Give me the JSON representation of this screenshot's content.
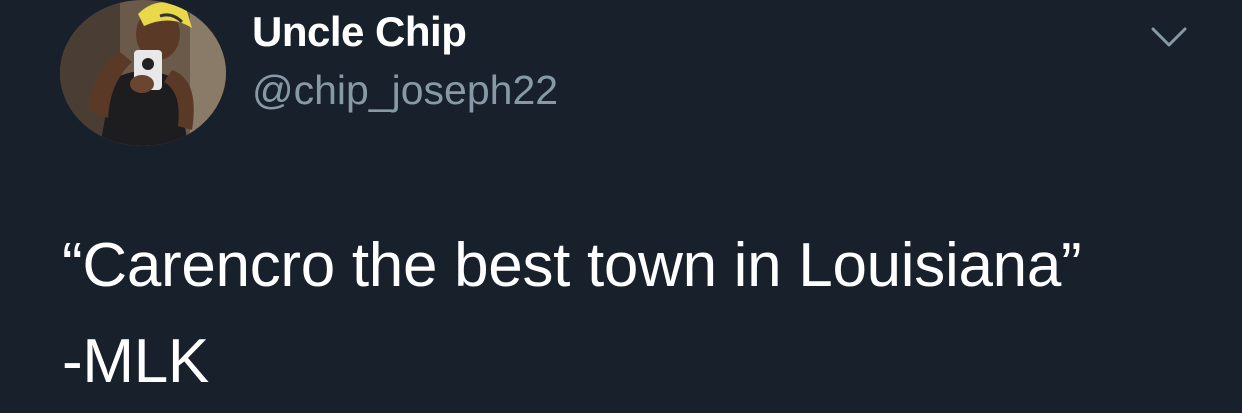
{
  "author": {
    "display_name": "Uncle Chip",
    "handle": "@chip_joseph22",
    "avatar_icon": "profile-photo"
  },
  "tweet": {
    "text": "“Carencro the best town in Louisiana”\n-MLK"
  },
  "menu": {
    "icon": "chevron-down-icon"
  },
  "colors": {
    "background": "#18202c",
    "primary_text": "#ffffff",
    "secondary_text": "#8899a6"
  }
}
